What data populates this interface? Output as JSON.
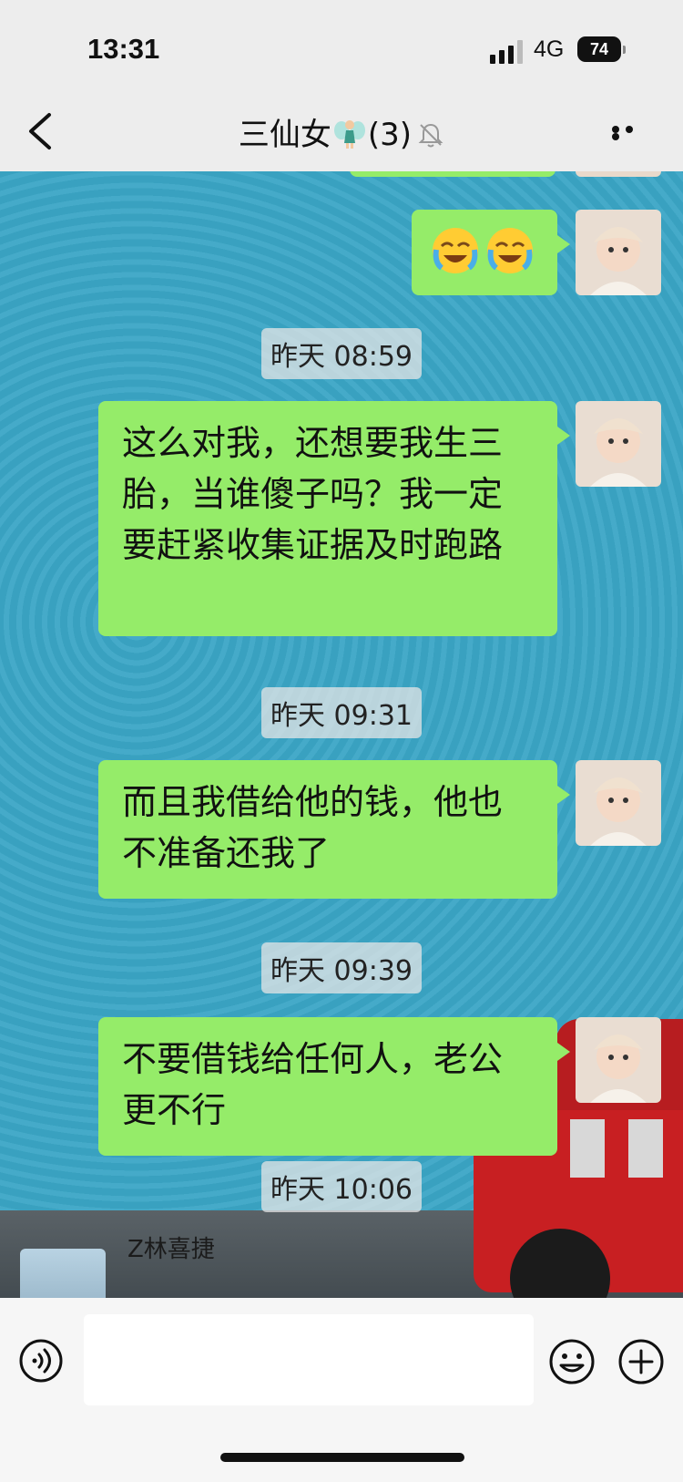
{
  "status_bar": {
    "time": "13:31",
    "network": "4G",
    "battery": "74"
  },
  "nav": {
    "title": "三仙女",
    "member_count": "(3)"
  },
  "messages": [
    {
      "type": "emoji",
      "content": [
        "face-with-tears-emoji",
        "face-with-tears-emoji"
      ]
    },
    {
      "type": "time",
      "text": "昨天 08:59"
    },
    {
      "type": "text",
      "text": "这么对我，还想要我生三胎，当谁傻子吗？我一定要赶紧收集证据及时跑路"
    },
    {
      "type": "time",
      "text": "昨天 09:31"
    },
    {
      "type": "text",
      "text": "而且我借给他的钱，他也不准备还我了"
    },
    {
      "type": "time",
      "text": "昨天 09:39"
    },
    {
      "type": "text",
      "text": "不要借钱给任何人，老公更不行"
    },
    {
      "type": "time",
      "text": "昨天 10:06"
    }
  ],
  "partial_sender": {
    "name": "Z林喜捷"
  },
  "input_bar": {
    "placeholder": ""
  },
  "colors": {
    "bubble": "#95ec69",
    "chat_bg": "#3ba6c6",
    "bar_bg": "#f6f6f6"
  }
}
